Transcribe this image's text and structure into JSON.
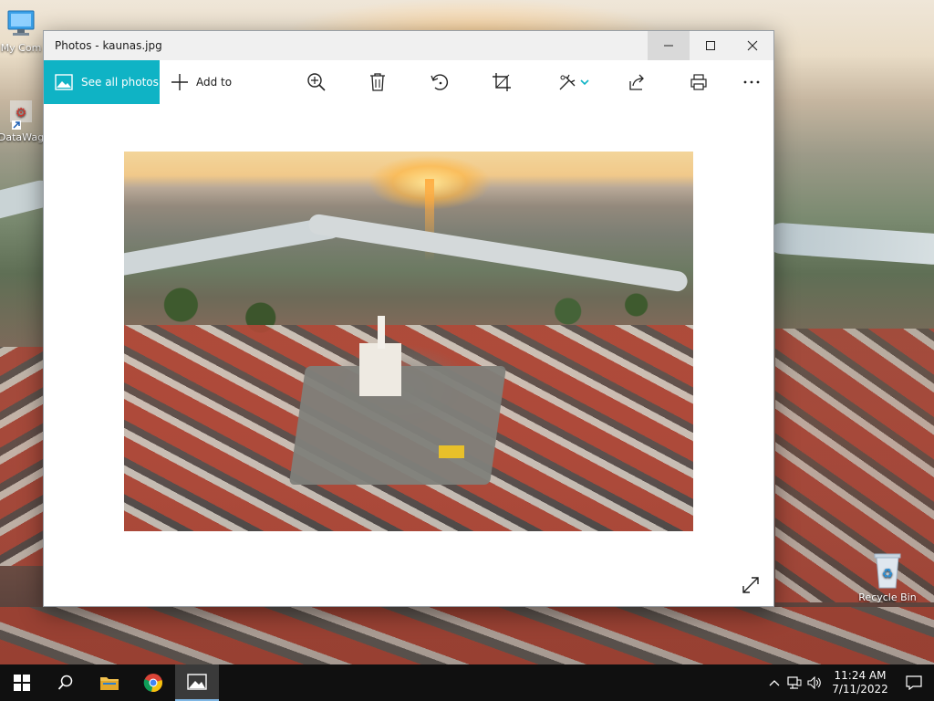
{
  "desktop": {
    "icons": [
      {
        "label": "My Com"
      },
      {
        "label": "DataWag"
      },
      {
        "label": "Recycle Bin"
      }
    ]
  },
  "window": {
    "title": "Photos - kaunas.jpg",
    "toolbar": {
      "see_all_label": "See all photos",
      "add_to_label": "Add to",
      "tools": [
        "zoom-icon",
        "delete-icon",
        "rotate-icon",
        "crop-icon",
        "edit-icon",
        "share-icon",
        "print-icon",
        "more-icon"
      ]
    }
  },
  "taskbar": {
    "clock_time": "11:24 AM",
    "clock_date": "7/11/2022"
  },
  "colors": {
    "accent": "#0fb3c5",
    "taskbar": "#101010",
    "titlebar": "#f0f0f0"
  }
}
